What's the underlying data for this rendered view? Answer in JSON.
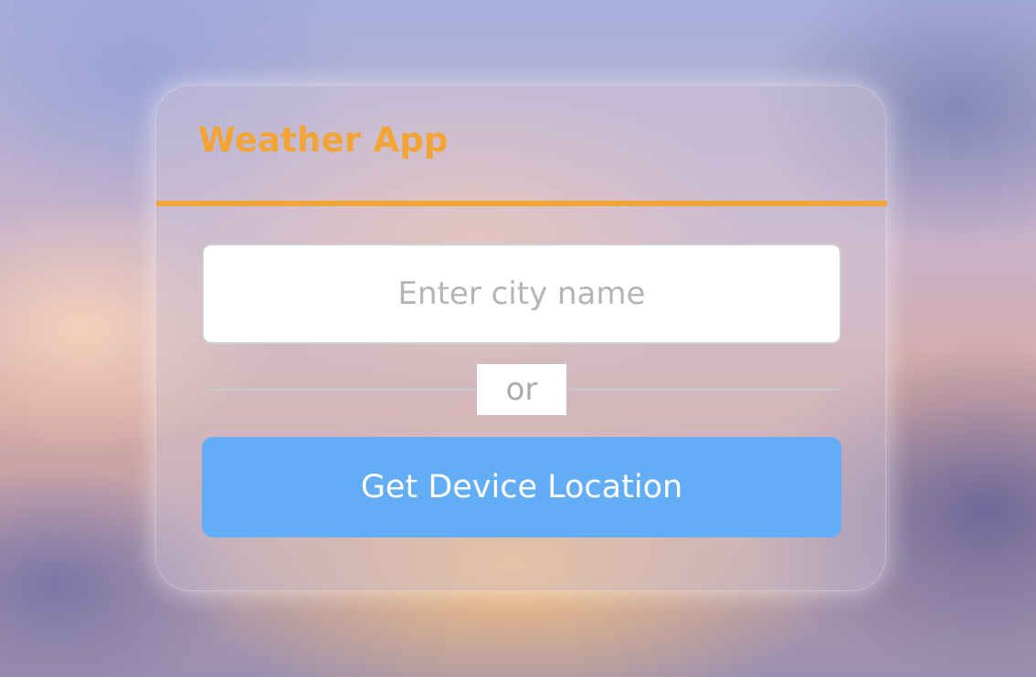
{
  "app": {
    "title": "Weather App"
  },
  "search": {
    "value": "",
    "placeholder": "Enter city name"
  },
  "separator": {
    "label": "or"
  },
  "location_button": {
    "label": "Get Device Location"
  },
  "colors": {
    "accent": "#f2a535",
    "button": "#63adf6",
    "input_border": "#cfcfcf",
    "placeholder": "#b4b4b4"
  }
}
